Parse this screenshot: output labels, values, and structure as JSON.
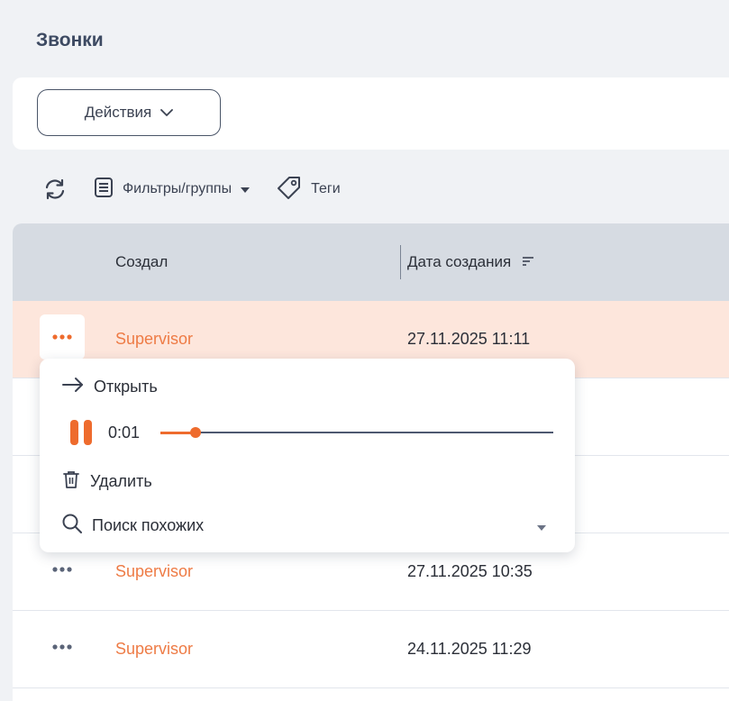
{
  "page": {
    "title": "Звонки"
  },
  "actions": {
    "label": "Действия"
  },
  "toolbar": {
    "filters_label": "Фильтры/группы",
    "tags_label": "Теги"
  },
  "table": {
    "columns": [
      "Создал",
      "Дата создания"
    ],
    "rows": [
      {
        "creator": "Supervisor",
        "date": "27.11.2025 11:11",
        "highlighted": true
      },
      {
        "creator": "",
        "date": "",
        "highlighted": false
      },
      {
        "creator": "",
        "date": "",
        "highlighted": false
      },
      {
        "creator": "Supervisor",
        "date": "27.11.2025 10:35",
        "highlighted": false
      },
      {
        "creator": "Supervisor",
        "date": "24.11.2025 11:29",
        "highlighted": false
      }
    ]
  },
  "context_menu": {
    "open_label": "Открыть",
    "player": {
      "time": "0:01",
      "progress": 0.09
    },
    "delete_label": "Удалить",
    "search_similar_label": "Поиск похожих"
  },
  "colors": {
    "accent": "#ee6b2d",
    "creator_link": "#ee7b45",
    "header_bg": "#d6dbe2",
    "highlight_row": "#fde6dc"
  }
}
